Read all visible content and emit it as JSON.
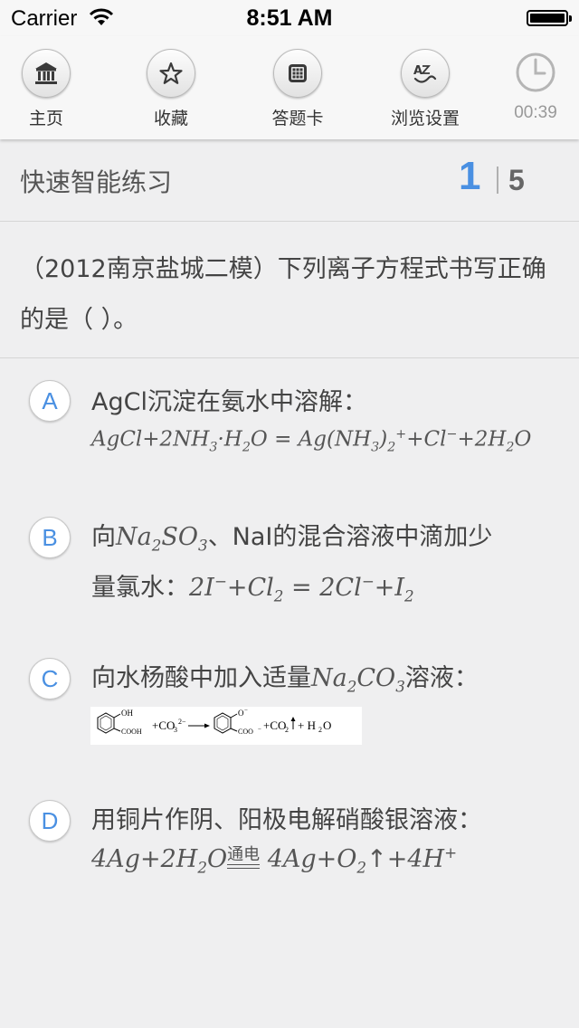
{
  "status": {
    "carrier": "Carrier",
    "time": "8:51 AM"
  },
  "toolbar": {
    "items": [
      {
        "label": "主页",
        "icon": "bank-icon"
      },
      {
        "label": "收藏",
        "icon": "star-icon"
      },
      {
        "label": "答题卡",
        "icon": "answer-card-icon"
      },
      {
        "label": "浏览设置",
        "icon": "font-settings-icon"
      }
    ],
    "timer": "00:39"
  },
  "header": {
    "title": "快速智能练习",
    "current": "1",
    "total": "5"
  },
  "question": {
    "text": "（2012南京盐城二模）下列离子方程式书写正确的是（ ）。"
  },
  "options": [
    {
      "letter": "A",
      "text_pre": "AgCl沉淀在氨水中溶解：",
      "equation": "AgCl+2NH3·H2O = Ag(NH3)2+ +Cl− +2H2O"
    },
    {
      "letter": "B",
      "text_pre": "向",
      "formula": "Na2SO3",
      "text_post": "、NaI的混合溶液中滴加少",
      "line2": "量氯水：",
      "equation": "2I− +Cl2 = 2Cl− +I2"
    },
    {
      "letter": "C",
      "text_pre": "向水杨酸中加入适量",
      "formula": "Na2CO3",
      "text_post": "溶液：",
      "reaction": "+CO3 2− → +CO2↑+H2O"
    },
    {
      "letter": "D",
      "text_pre": "用铜片作阴、阳极电解硝酸银溶液：",
      "condition": "通电",
      "equation": "4Ag+2H2O 通电 4Ag+O2↑+4H+"
    }
  ],
  "colors": {
    "accent": "#4a90e2",
    "background": "#efeff0",
    "bar": "#f7f7f7"
  }
}
